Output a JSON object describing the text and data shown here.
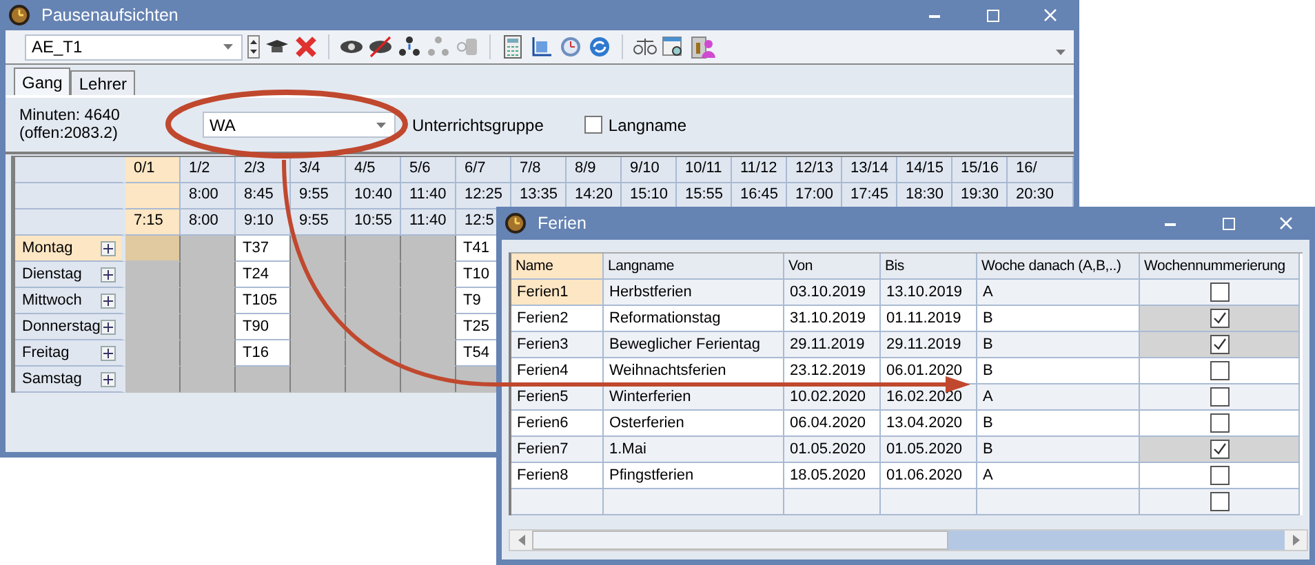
{
  "main_window": {
    "title": "Pausenaufsichten",
    "toolbar": {
      "selector": "AE_T1"
    },
    "tabs": [
      {
        "label": "Gang",
        "selected": true
      },
      {
        "label": "Lehrer",
        "selected": false
      }
    ],
    "summary": [
      "Minuten: 4640",
      "(offen:2083.2)"
    ],
    "group_select": {
      "value": "WA",
      "label": "Unterrichtsgruppe"
    },
    "langname": {
      "label": "Langname",
      "checked": false
    },
    "grid": {
      "periods": [
        "0/1",
        "1/2",
        "2/3",
        "3/4",
        "4/5",
        "5/6",
        "6/7",
        "7/8",
        "8/9",
        "9/10",
        "10/11",
        "11/12",
        "12/13",
        "13/14",
        "14/15",
        "15/16",
        "16/"
      ],
      "start_times": [
        "8:00",
        "8:45",
        "9:55",
        "10:40",
        "11:40",
        "12:25",
        "13:35",
        "14:20",
        "15:10",
        "15:55",
        "16:45",
        "17:00",
        "17:45",
        "18:30",
        "19:30",
        "20:30"
      ],
      "end_times": [
        "7:15",
        "8:00",
        "9:10",
        "9:55",
        "10:55",
        "11:40",
        "12:5"
      ],
      "days": [
        {
          "label": "Montag",
          "selected": true,
          "cells": [
            null,
            null,
            "T37",
            null,
            null,
            null,
            "T41"
          ]
        },
        {
          "label": "Dienstag",
          "selected": false,
          "cells": [
            null,
            null,
            "T24",
            null,
            null,
            null,
            "T10"
          ]
        },
        {
          "label": "Mittwoch",
          "selected": false,
          "cells": [
            null,
            null,
            "T105",
            null,
            null,
            null,
            "T9"
          ]
        },
        {
          "label": "Donnerstag",
          "selected": false,
          "cells": [
            null,
            null,
            "T90",
            null,
            null,
            null,
            "T25"
          ]
        },
        {
          "label": "Freitag",
          "selected": false,
          "cells": [
            null,
            null,
            "T16",
            null,
            null,
            null,
            "T54"
          ]
        },
        {
          "label": "Samstag",
          "selected": false,
          "cells": [
            null,
            null,
            null,
            null,
            null,
            null,
            null
          ]
        }
      ]
    }
  },
  "ferien_window": {
    "title": "Ferien",
    "columns": [
      "Name",
      "Langname",
      "Von",
      "Bis",
      "Woche danach (A,B,..)",
      "Wochennummerierung"
    ],
    "rows": [
      {
        "cells": [
          "Ferien1",
          "Herbstferien",
          "03.10.2019",
          "13.10.2019",
          "A"
        ],
        "checked": false,
        "selected": true
      },
      {
        "cells": [
          "Ferien2",
          "Reformationstag",
          "31.10.2019",
          "01.11.2019",
          "B"
        ],
        "checked": true,
        "selected": false
      },
      {
        "cells": [
          "Ferien3",
          "Beweglicher Ferientag",
          "29.11.2019",
          "29.11.2019",
          "B"
        ],
        "checked": true,
        "selected": false
      },
      {
        "cells": [
          "Ferien4",
          "Weihnachtsferien",
          "23.12.2019",
          "06.01.2020",
          "B"
        ],
        "checked": false,
        "selected": false
      },
      {
        "cells": [
          "Ferien5",
          "Winterferien",
          "10.02.2020",
          "16.02.2020",
          "A"
        ],
        "checked": false,
        "selected": false
      },
      {
        "cells": [
          "Ferien6",
          "Osterferien",
          "06.04.2020",
          "13.04.2020",
          "B"
        ],
        "checked": false,
        "selected": false
      },
      {
        "cells": [
          "Ferien7",
          "1.Mai",
          "01.05.2020",
          "01.05.2020",
          "B"
        ],
        "checked": true,
        "selected": false
      },
      {
        "cells": [
          "Ferien8",
          "Pfingstferien",
          "18.05.2020",
          "01.06.2020",
          "A"
        ],
        "checked": false,
        "selected": false
      },
      {
        "cells": [],
        "checked": false,
        "selected": false
      }
    ]
  }
}
